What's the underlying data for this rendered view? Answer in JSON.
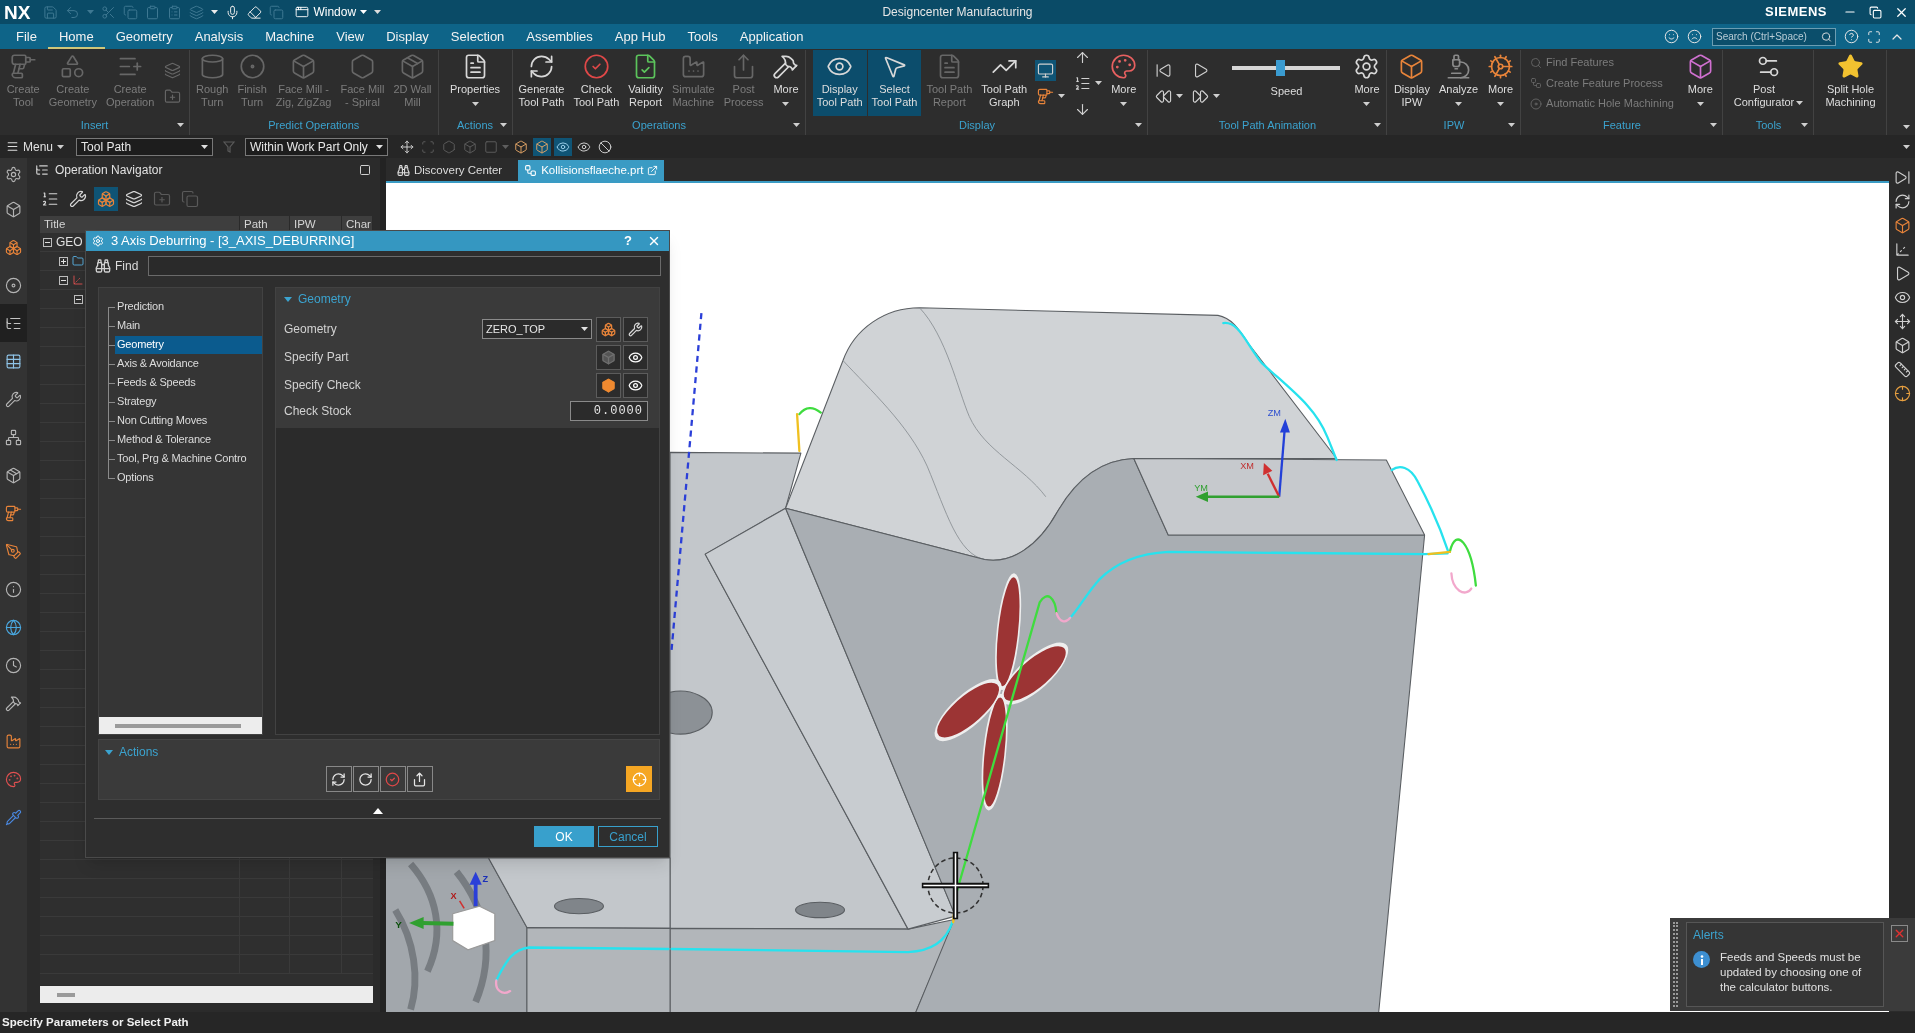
{
  "title_bar": {
    "logo": "NX",
    "quick_access": [
      {
        "disabled": true
      },
      {
        "disabled": true
      },
      {
        "disabled": true
      },
      {
        "disabled": true
      },
      {
        "disabled": true
      },
      {
        "disabled": true
      },
      {
        "disabled": true
      },
      {
        "disabled": true
      },
      {
        "disabled": false
      },
      {
        "disabled": false
      },
      {
        "disabled": false
      },
      {
        "disabled": true
      }
    ],
    "window_menu": "Window",
    "title": "Designcenter Manufacturing",
    "brand": "SIEMENS"
  },
  "menu_bar": {
    "tabs": [
      {
        "label": "File",
        "selected": false
      },
      {
        "label": "Home",
        "selected": true
      },
      {
        "label": "Geometry",
        "selected": false
      },
      {
        "label": "Analysis",
        "selected": false
      },
      {
        "label": "Machine",
        "selected": false
      },
      {
        "label": "View",
        "selected": false
      },
      {
        "label": "Display",
        "selected": false
      },
      {
        "label": "Selection",
        "selected": false
      },
      {
        "label": "Assemblies",
        "selected": false
      },
      {
        "label": "App Hub",
        "selected": false
      },
      {
        "label": "Tools",
        "selected": false
      },
      {
        "label": "Application",
        "selected": false
      }
    ],
    "search": {
      "placeholder": "Search (Ctrl+Space)"
    }
  },
  "ribbon": {
    "groups": [
      {
        "label": "Insert",
        "menu": true,
        "items": [
          {
            "kind": "big",
            "label": "Create\nTool",
            "disabled": true,
            "active": false
          },
          {
            "kind": "big",
            "label": "Create\nGeometry",
            "disabled": true,
            "active": false
          },
          {
            "kind": "big",
            "label": "Create\nOperation",
            "disabled": true,
            "active": false
          },
          {
            "kind": "icons",
            "icons": [
              {
                "disabled": true,
                "active": false
              },
              {
                "disabled": true,
                "active": false
              }
            ]
          }
        ]
      },
      {
        "label": "Predict Operations",
        "items": [
          {
            "kind": "big",
            "label": "Rough\nTurn",
            "disabled": true,
            "active": false
          },
          {
            "kind": "big",
            "label": "Finish\nTurn",
            "disabled": true,
            "active": false
          },
          {
            "kind": "big",
            "label": "Face Mill -\nZig, ZigZag",
            "disabled": true,
            "active": false
          },
          {
            "kind": "big",
            "label": "Face Mill\n- Spiral",
            "disabled": true,
            "active": false
          },
          {
            "kind": "big",
            "label": "2D Wall\nMill",
            "disabled": true,
            "active": false
          }
        ]
      },
      {
        "label": "Actions",
        "menu": true,
        "items": [
          {
            "kind": "big",
            "label": "Properties",
            "disabled": false,
            "active": false,
            "dropdown": true
          }
        ]
      },
      {
        "label": "Operations",
        "menu": true,
        "items": [
          {
            "kind": "big",
            "label": "Generate\nTool Path",
            "disabled": false,
            "active": false
          },
          {
            "kind": "big",
            "label": "Check\nTool Path",
            "disabled": false,
            "active": false
          },
          {
            "kind": "big",
            "label": "Validity\nReport",
            "disabled": false,
            "active": false
          },
          {
            "kind": "big",
            "label": "Simulate\nMachine",
            "disabled": true,
            "active": false
          },
          {
            "kind": "big",
            "label": "Post\nProcess",
            "disabled": true,
            "active": false
          },
          {
            "kind": "big",
            "label": "More",
            "disabled": false,
            "active": false,
            "dropdown": true
          }
        ]
      },
      {
        "label": "Display",
        "menu": true,
        "items": [
          {
            "kind": "big",
            "label": "Display\nTool Path",
            "disabled": false,
            "active": true
          },
          {
            "kind": "big",
            "label": "Select\nTool Path",
            "disabled": false,
            "active": true
          },
          {
            "kind": "big",
            "label": "Tool Path\nReport",
            "disabled": true,
            "active": false
          },
          {
            "kind": "big",
            "label": "Tool Path\nGraph",
            "disabled": false,
            "active": false
          },
          {
            "kind": "icons",
            "icons": [
              {
                "disabled": false,
                "active": true
              },
              {
                "disabled": false,
                "active": false,
                "dropdown": true
              }
            ]
          },
          {
            "kind": "icons",
            "icons": [
              {
                "disabled": false,
                "active": false
              },
              {
                "disabled": false,
                "active": false,
                "dropdown": true
              },
              {
                "disabled": false,
                "active": false
              }
            ]
          },
          {
            "kind": "big",
            "label": "More",
            "disabled": false,
            "active": false,
            "dropdown": true
          }
        ]
      },
      {
        "label": "Tool Path Animation",
        "menu": true,
        "items": [
          {
            "kind": "icons",
            "icons": [
              {
                "disabled": false,
                "active": false
              },
              {
                "disabled": false,
                "active": false,
                "dropdown": true
              }
            ]
          },
          {
            "kind": "icons",
            "icons": [
              {
                "disabled": false,
                "active": false
              },
              {
                "disabled": false,
                "active": false,
                "dropdown": true
              }
            ]
          },
          {
            "kind": "slider",
            "label": "Speed",
            "level": 0.44
          },
          {
            "kind": "big",
            "label": "More",
            "disabled": false,
            "active": false,
            "dropdown": true
          }
        ]
      },
      {
        "label": "IPW",
        "menu": true,
        "items": [
          {
            "kind": "big",
            "label": "Display\nIPW",
            "disabled": false,
            "active": false
          },
          {
            "kind": "big",
            "label": "Analyze",
            "disabled": false,
            "active": false,
            "dropdown": true
          },
          {
            "kind": "big",
            "label": "More",
            "disabled": false,
            "active": false,
            "dropdown": true
          }
        ]
      },
      {
        "label": "Feature",
        "menu": true,
        "items": [
          {
            "kind": "list",
            "rows": [
              {
                "label": "Find Features",
                "disabled": true
              },
              {
                "label": "Create Feature Process",
                "disabled": true
              },
              {
                "label": "Automatic Hole Machining",
                "disabled": true
              }
            ]
          },
          {
            "kind": "big",
            "label": "More",
            "disabled": false,
            "active": false,
            "dropdown": true
          }
        ]
      },
      {
        "label": "Tools",
        "menu": true,
        "items": [
          {
            "kind": "big",
            "label": "Post\nConfigurator",
            "disabled": false,
            "active": false,
            "dropdown": true
          }
        ]
      },
      {
        "items": [
          {
            "kind": "big",
            "label": "Split Hole\nMachining",
            "disabled": false,
            "active": false
          }
        ]
      }
    ]
  },
  "toolbar": {
    "menu": "Menu",
    "type_filter": "Tool Path",
    "filter_icon": {
      "disabled": true
    },
    "scope": "Within Work Part Only",
    "tools": [
      {
        "active": false,
        "disabled": false
      },
      {
        "active": false,
        "disabled": true
      },
      {
        "active": false,
        "disabled": true
      },
      {
        "active": false,
        "disabled": true
      },
      {
        "active": false,
        "disabled": true,
        "dropdown": true
      },
      {
        "active": false,
        "disabled": false
      },
      {
        "active": true,
        "disabled": false
      },
      {
        "active": true,
        "disabled": false
      },
      {
        "active": false,
        "disabled": false
      },
      {
        "active": false,
        "disabled": false
      }
    ]
  },
  "resource_bar": [
    {
      "selected": false
    },
    {
      "selected": false
    },
    {
      "selected": false
    },
    {
      "selected": false
    },
    {
      "selected": true
    },
    {
      "selected": false
    },
    {
      "selected": false
    },
    {
      "selected": false
    },
    {
      "selected": false
    },
    {
      "selected": false
    },
    {
      "selected": false
    },
    {
      "selected": false
    },
    {
      "selected": false
    },
    {
      "selected": false
    },
    {
      "selected": false
    },
    {
      "selected": false
    },
    {
      "selected": false
    },
    {
      "selected": false
    }
  ],
  "navigator": {
    "title": "Operation Navigator",
    "view_buttons": [
      {
        "selected": false,
        "disabled": false
      },
      {
        "selected": false,
        "disabled": false
      },
      {
        "selected": true,
        "disabled": false
      },
      {
        "selected": false,
        "disabled": false
      },
      {
        "selected": false,
        "disabled": true
      },
      {
        "selected": false,
        "disabled": true
      }
    ],
    "columns": [
      "Title",
      "Path",
      "IPW",
      "Char"
    ],
    "tree": [
      {
        "title": "GEO",
        "expanded": true,
        "children": [
          {
            "expanded": false
          },
          {
            "expanded": true,
            "children": [
              {
                "expanded": true
              }
            ]
          }
        ]
      }
    ]
  },
  "documents": [
    {
      "label": "Discovery Center",
      "selected": false
    },
    {
      "label": "Kollisionsflaeche.prt",
      "selected": true
    }
  ],
  "viewport": {
    "wcs_labels": [
      "ZM",
      "XM",
      "YM"
    ],
    "triad_labels": [
      "Z",
      "Y",
      "X"
    ]
  },
  "dialog": {
    "title": "3 Axis Deburring - [3_AXIS_DEBURRING]",
    "help": "?",
    "find_label": "Find",
    "pages": [
      {
        "label": "Prediction",
        "selected": false
      },
      {
        "label": "Main",
        "selected": false
      },
      {
        "label": "Geometry",
        "selected": true
      },
      {
        "label": "Axis & Avoidance",
        "selected": false
      },
      {
        "label": "Feeds & Speeds",
        "selected": false
      },
      {
        "label": "Strategy",
        "selected": false
      },
      {
        "label": "Non Cutting Moves",
        "selected": false
      },
      {
        "label": "Method & Tolerance",
        "selected": false
      },
      {
        "label": "Tool, Prg & Machine Contro",
        "selected": false
      },
      {
        "label": "Options",
        "selected": false
      }
    ],
    "geometry": {
      "title": "Geometry",
      "expanded": true,
      "rows": [
        {
          "kind": "select",
          "label": "Geometry",
          "value": "ZERO_TOP"
        },
        {
          "kind": "pick",
          "label": "Specify Part",
          "specified": false
        },
        {
          "kind": "pick",
          "label": "Specify Check",
          "specified": true
        },
        {
          "kind": "number",
          "label": "Check Stock",
          "value": "0.0000"
        }
      ]
    },
    "actions": {
      "title": "Actions",
      "expanded": true
    },
    "buttons": [
      "OK",
      "Cancel"
    ]
  },
  "alerts": {
    "title": "Alerts",
    "message": "Feeds and Speeds must be updated by choosing one of the calculator buttons."
  },
  "status_bar": {
    "message": "Specify Parameters or Select Path"
  }
}
